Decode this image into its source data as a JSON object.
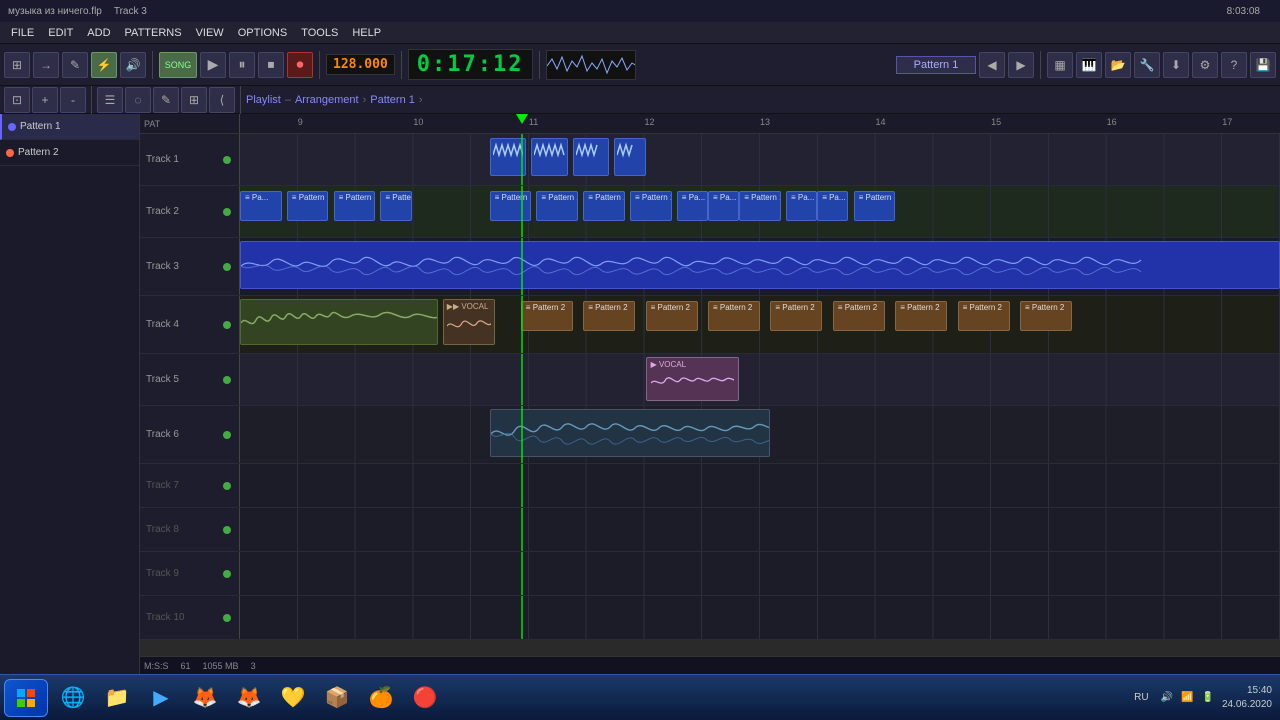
{
  "title": {
    "project_name": "музыка из ничего.flp",
    "track_info": "Track 3",
    "time": "8:03:08"
  },
  "menu": {
    "items": [
      "FILE",
      "EDIT",
      "ADD",
      "PATTERNS",
      "VIEW",
      "OPTIONS",
      "TOOLS",
      "HELP"
    ]
  },
  "toolbar": {
    "bpm": "128.000",
    "time_display": "0:17:12",
    "pattern": "Pattern 1",
    "line_mode": "Line",
    "song_btn": "SONG",
    "play_icon": "▶",
    "pause_icon": "⏸",
    "stop_icon": "⏹",
    "record_icon": "⏺"
  },
  "breadcrumb": {
    "root": "Playlist",
    "sep1": "–",
    "mid": "Arrangement",
    "sep2": "›",
    "current": "Pattern 1"
  },
  "patterns": [
    {
      "id": 1,
      "name": "Pattern 1",
      "color": "#6666ff",
      "active": true
    },
    {
      "id": 2,
      "name": "Pattern 2",
      "color": "#ff6644",
      "active": false
    }
  ],
  "timeline": {
    "markers": [
      "9",
      "10",
      "11",
      "12",
      "13",
      "14",
      "15",
      "16",
      "17"
    ],
    "playhead_pct": 27
  },
  "tracks": [
    {
      "id": 1,
      "name": "Track 1",
      "type": "midi",
      "empty": false
    },
    {
      "id": 2,
      "name": "Track 2",
      "type": "pattern",
      "empty": false
    },
    {
      "id": 3,
      "name": "Track 3",
      "type": "audio",
      "empty": false
    },
    {
      "id": 4,
      "name": "Track 4",
      "type": "mixed",
      "empty": false
    },
    {
      "id": 5,
      "name": "Track 5",
      "type": "audio",
      "empty": false
    },
    {
      "id": 6,
      "name": "Track 6",
      "type": "audio",
      "empty": false
    },
    {
      "id": 7,
      "name": "Track 7",
      "type": "empty",
      "empty": true
    },
    {
      "id": 8,
      "name": "Track 8",
      "type": "empty",
      "empty": true
    },
    {
      "id": 9,
      "name": "Track 9",
      "type": "empty",
      "empty": true
    },
    {
      "id": 10,
      "name": "Track 10",
      "type": "empty",
      "empty": true
    }
  ],
  "info_bar": {
    "ms": "M:S:S",
    "value1": "61",
    "value2": "1055 MB",
    "value3": "3"
  },
  "taskbar": {
    "apps": [
      "🪟",
      "🌐",
      "📁",
      "▶",
      "🦊",
      "🦊",
      "💛",
      "📦",
      "🍊",
      "🔴"
    ],
    "locale": "RU",
    "time": "15:40",
    "date": "24.06.2020"
  }
}
